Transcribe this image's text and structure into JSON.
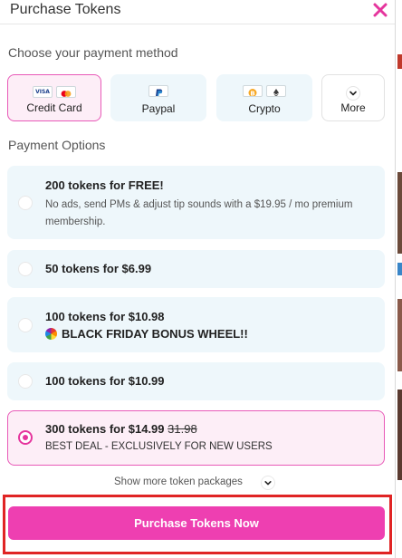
{
  "header": {
    "title": "Purchase Tokens"
  },
  "payment_method": {
    "label": "Choose your payment method",
    "methods": [
      {
        "label": "Credit Card",
        "selected": true,
        "icons": [
          "visa-icon",
          "mastercard-icon"
        ]
      },
      {
        "label": "Paypal",
        "selected": false,
        "icons": [
          "paypal-icon"
        ]
      },
      {
        "label": "Crypto",
        "selected": false,
        "icons": [
          "bitcoin-icon",
          "ethereum-icon"
        ]
      },
      {
        "label": "More",
        "selected": false,
        "icons": [
          "chevron-down-icon"
        ]
      }
    ],
    "visa_text": "VISA"
  },
  "payment_options": {
    "label": "Payment Options",
    "options": [
      {
        "title": "200 tokens for FREE!",
        "desc": "No ads, send PMs & adjust tip sounds with a $19.95 / mo premium membership.",
        "selected": false
      },
      {
        "title": "50 tokens for $6.99",
        "selected": false
      },
      {
        "title": "100 tokens for $10.98",
        "bonus": "BLACK FRIDAY BONUS WHEEL!!",
        "selected": false
      },
      {
        "title": "100 tokens for $10.99",
        "selected": false
      },
      {
        "title": "300 tokens for $14.99",
        "old_price": "31.98",
        "sub": "BEST DEAL - EXCLUSIVELY FOR NEW USERS",
        "selected": true
      }
    ]
  },
  "show_more": {
    "label": "Show more token packages"
  },
  "purchase": {
    "label": "Purchase Tokens Now"
  },
  "colors": {
    "accent": "#ee3fb1",
    "selected_border": "#e85ab8",
    "option_bg": "#eef7fb",
    "selected_bg": "#fdeef7",
    "highlight_frame": "#e02424"
  }
}
